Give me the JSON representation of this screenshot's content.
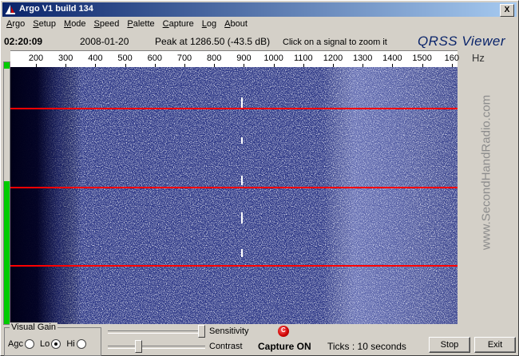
{
  "window": {
    "title": "Argo V1 build 134",
    "close_glyph": "X"
  },
  "menu": [
    "Argo",
    "Setup",
    "Mode",
    "Speed",
    "Palette",
    "Capture",
    "Log",
    "About"
  ],
  "info": {
    "time": "02:20:09",
    "date": "2008-01-20",
    "peak": "Peak at 1286.50 (-43.5 dB)",
    "hint": "Click on a signal to zoom it",
    "brand": "QRSS Viewer"
  },
  "scale": {
    "labels": [
      "200",
      "300",
      "400",
      "500",
      "600",
      "700",
      "800",
      "900",
      "1000",
      "1100",
      "1200",
      "1300",
      "1400",
      "1500",
      "160"
    ],
    "values": [
      200,
      300,
      400,
      500,
      600,
      700,
      800,
      900,
      1000,
      1100,
      1200,
      1300,
      1400,
      1500,
      1600
    ],
    "unit": "Hz"
  },
  "watermark": "www.SecondHandRadio.com",
  "level": {
    "fraction": 0.55
  },
  "colors": {
    "marker_line": "#ff0000",
    "waterfall_dark": "#0a0a30",
    "waterfall_blue": "#26327a"
  },
  "controls": {
    "visual_gain_label": "Visual Gain",
    "agc_label": "Agc",
    "lo_label": "Lo",
    "hi_label": "Hi",
    "selected_gain": "Lo",
    "sensitivity_label": "Sensitivity",
    "sensitivity_value": 1.0,
    "contrast_label": "Contrast",
    "contrast_value": 0.3,
    "capture_status": "Capture ON",
    "ticks_text": "Ticks  : 10 seconds",
    "stop_label": "Stop",
    "exit_label": "Exit"
  }
}
